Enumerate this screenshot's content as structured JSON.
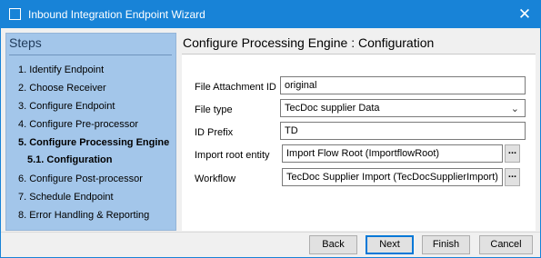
{
  "window": {
    "title": "Inbound Integration Endpoint Wizard",
    "close_glyph": "✕",
    "app_icon": "window-icon",
    "close_icon": "close-icon"
  },
  "steps": {
    "header": "Steps",
    "items": [
      {
        "label": "1. Identify Endpoint",
        "active": false
      },
      {
        "label": "2. Choose Receiver",
        "active": false
      },
      {
        "label": "3. Configure Endpoint",
        "active": false
      },
      {
        "label": "4. Configure Pre-processor",
        "active": false
      },
      {
        "label": "5. Configure Processing Engine",
        "active": true
      },
      {
        "label": "5.1. Configuration",
        "active": true
      },
      {
        "label": "6. Configure Post-processor",
        "active": false
      },
      {
        "label": "7. Schedule Endpoint",
        "active": false
      },
      {
        "label": "8. Error Handling & Reporting",
        "active": false
      }
    ]
  },
  "main": {
    "title": "Configure Processing Engine : Configuration",
    "fields": {
      "file_attachment_id": {
        "label": "File Attachment ID",
        "value": "original"
      },
      "file_type": {
        "label": "File type",
        "value": "TecDoc supplier Data",
        "icon": "chevron-down-icon"
      },
      "id_prefix": {
        "label": "ID Prefix",
        "value": "TD"
      },
      "import_root_entity": {
        "label": "Import root entity",
        "value": "Import Flow Root (ImportflowRoot)",
        "button": "..."
      },
      "workflow": {
        "label": "Workflow",
        "value": "TecDoc Supplier Import (TecDocSupplierImport)",
        "button": "..."
      }
    }
  },
  "footer": {
    "back": "Back",
    "next": "Next",
    "finish": "Finish",
    "cancel": "Cancel"
  },
  "colors": {
    "titlebar": "#1883d7",
    "steps_panel": "#a3c6ea",
    "default_button_border": "#0078d7"
  }
}
